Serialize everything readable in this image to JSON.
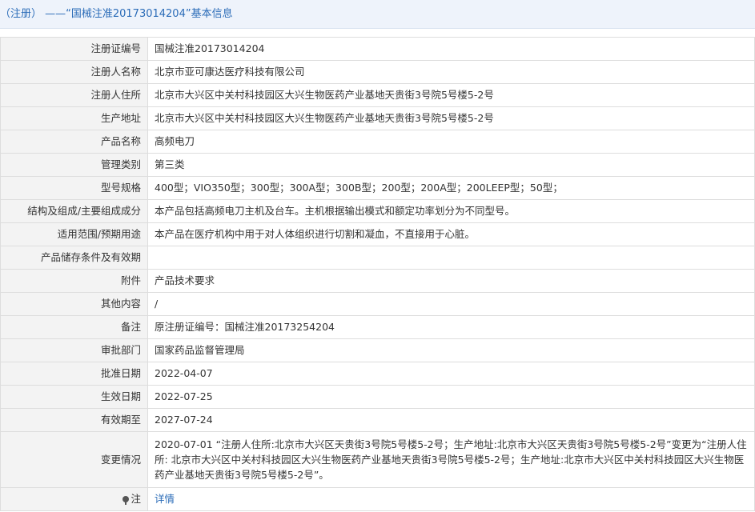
{
  "header": {
    "title": "（注册） ——“国械注准20173014204”基本信息"
  },
  "rows": [
    {
      "label": "注册证编号",
      "value": "国械注准20173014204"
    },
    {
      "label": "注册人名称",
      "value": "北京市亚可康达医疗科技有限公司"
    },
    {
      "label": "注册人住所",
      "value": "北京市大兴区中关村科技园区大兴生物医药产业基地天贵街3号院5号楼5-2号"
    },
    {
      "label": "生产地址",
      "value": "北京市大兴区中关村科技园区大兴生物医药产业基地天贵街3号院5号楼5-2号"
    },
    {
      "label": "产品名称",
      "value": "高频电刀"
    },
    {
      "label": "管理类别",
      "value": "第三类"
    },
    {
      "label": "型号规格",
      "value": "400型；VIO350型；300型；300A型；300B型；200型；200A型；200LEEP型；50型；"
    },
    {
      "label": "结构及组成/主要组成成分",
      "value": "本产品包括高频电刀主机及台车。主机根据输出模式和额定功率划分为不同型号。"
    },
    {
      "label": "适用范围/预期用途",
      "value": "本产品在医疗机构中用于对人体组织进行切割和凝血，不直接用于心脏。"
    },
    {
      "label": "产品储存条件及有效期",
      "value": ""
    },
    {
      "label": "附件",
      "value": "产品技术要求"
    },
    {
      "label": "其他内容",
      "value": "/"
    },
    {
      "label": "备注",
      "value": "原注册证编号：国械注准20173254204"
    },
    {
      "label": "审批部门",
      "value": "国家药品监督管理局"
    },
    {
      "label": "批准日期",
      "value": "2022-04-07"
    },
    {
      "label": "生效日期",
      "value": "2022-07-25"
    },
    {
      "label": "有效期至",
      "value": "2027-07-24"
    },
    {
      "label": "变更情况",
      "value": "2020-07-01 “注册人住所:北京市大兴区天贵街3号院5号楼5-2号；生产地址:北京市大兴区天贵街3号院5号楼5-2号”变更为“注册人住所: 北京市大兴区中关村科技园区大兴生物医药产业基地天贵街3号院5号楼5-2号；生产地址:北京市大兴区中关村科技园区大兴生物医药产业基地天贵街3号院5号楼5-2号”。"
    }
  ],
  "note_row": {
    "label": "注",
    "icon": "pin-icon",
    "link_text": "详情"
  }
}
